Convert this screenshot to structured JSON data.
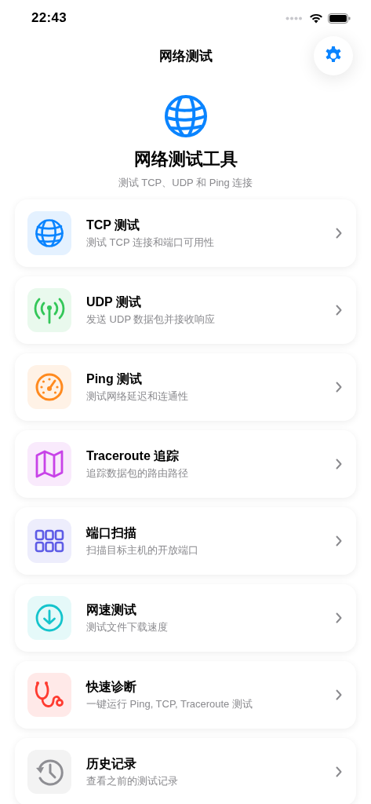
{
  "status_bar": {
    "time": "22:43"
  },
  "nav": {
    "title": "网络测试"
  },
  "hero": {
    "title": "网络测试工具",
    "subtitle": "测试 TCP、UDP 和 Ping 连接"
  },
  "tools": [
    {
      "kind": "globe",
      "title": "TCP 测试",
      "subtitle": "测试 TCP 连接和端口可用性",
      "color": "#0a84ff"
    },
    {
      "kind": "antenna",
      "title": "UDP 测试",
      "subtitle": "发送 UDP 数据包并接收响应",
      "color": "#34c759"
    },
    {
      "kind": "gauge",
      "title": "Ping 测试",
      "subtitle": "测试网络延迟和连通性",
      "color": "#ff8a1f"
    },
    {
      "kind": "map",
      "title": "Traceroute 追踪",
      "subtitle": "追踪数据包的路由路径",
      "color": "#c843e8"
    },
    {
      "kind": "grid",
      "title": "端口扫描",
      "subtitle": "扫描目标主机的开放端口",
      "color": "#5e5ce6"
    },
    {
      "kind": "download",
      "title": "网速测试",
      "subtitle": "测试文件下载速度",
      "color": "#14c4cc"
    },
    {
      "kind": "stethoscope",
      "title": "快速诊断",
      "subtitle": "一键运行 Ping, TCP, Traceroute 测试",
      "color": "#ff3b30"
    },
    {
      "kind": "history",
      "title": "历史记录",
      "subtitle": "查看之前的测试记录",
      "color": "#8e8e93"
    }
  ]
}
